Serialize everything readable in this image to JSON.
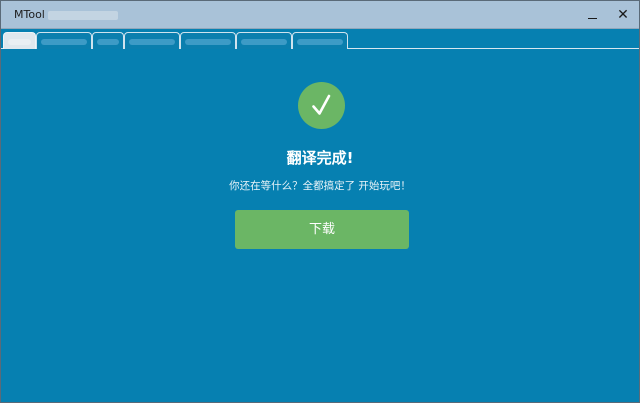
{
  "window": {
    "title": "MTool"
  },
  "titlebar": {
    "minimize_glyph": "—",
    "close_glyph": "✕"
  },
  "tabs": [
    {
      "label": "",
      "active": true
    },
    {
      "label": "",
      "active": false
    },
    {
      "label": "",
      "active": false
    },
    {
      "label": "",
      "active": false
    },
    {
      "label": "",
      "active": false
    },
    {
      "label": "",
      "active": false
    },
    {
      "label": "",
      "active": false
    }
  ],
  "main": {
    "status_icon": "check-icon",
    "headline": "翻译完成!",
    "message": "你还在等什么？全都搞定了 开始玩吧！",
    "download_label": "下载"
  },
  "colors": {
    "background": "#0680b1",
    "titlebar": "#a9c2d8",
    "success_green": "#6bb665",
    "text_white": "#ffffff"
  }
}
